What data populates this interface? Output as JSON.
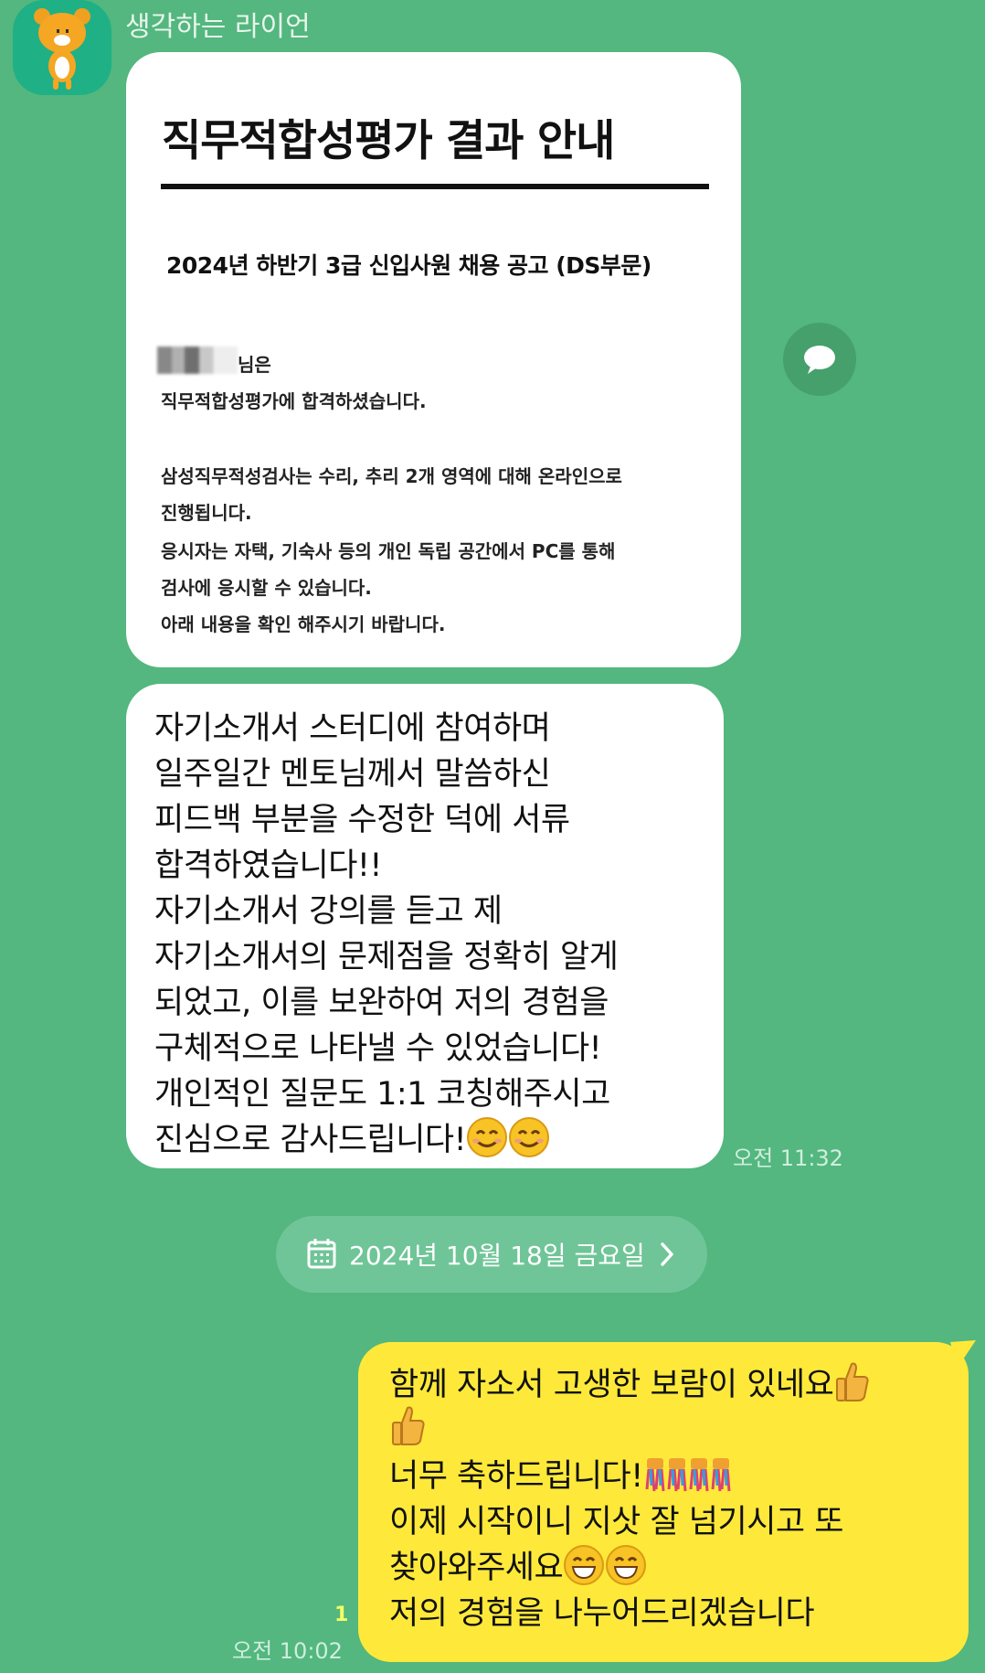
{
  "chat": {
    "sender_name": "생각하는 라이언",
    "notice": {
      "title": "직무적합성평가 결과 안내",
      "subtitle": "2024년 하반기 3급 신입사원 채용 공고 (DS부문)",
      "name_suffix": "님은",
      "line1": "직무적합성평가에 합격하셨습니다.",
      "line2": "삼성직무적성검사는 수리, 추리 2개 영역에 대해 온라인으로",
      "line3": "진행됩니다.",
      "line4": "응시자는 자택, 기숙사 등의 개인 독립 공간에서 PC를 통해",
      "line5": "검사에 응시할 수 있습니다.",
      "line6": "아래 내용을 확인 해주시기 바랍니다."
    },
    "message_left": {
      "lines": [
        "자기소개서 스터디에 참여하며",
        "일주일간 멘토님께서 말씀하신",
        "피드백 부분을 수정한 덕에 서류",
        "합격하였습니다!!",
        "자기소개서 강의를 듣고 제",
        "자기소개서의 문제점을 정확히 알게",
        "되었고, 이를 보완하여 저의 경험을",
        "구체적으로 나타낼 수 있었습니다!",
        "개인적인 질문도 1:1 코칭해주시고",
        "진심으로 감사드립니다!"
      ],
      "time": "오전 11:32"
    },
    "date_divider": "2024년 10월 18일 금요일",
    "message_right": {
      "lines": [
        "함께 자소서 고생한 보람이 있네요",
        "",
        "너무 축하드립니다!",
        "이제 시작이니 지삿 잘 넘기시고 또",
        "찾아와주세요",
        "저의 경험을 나누어드리겠습니다"
      ],
      "unread_count": "1",
      "time": "오전 10:02"
    },
    "colors": {
      "background": "#53b77f",
      "my_bubble": "#fee93a",
      "other_bubble": "#ffffff"
    }
  }
}
